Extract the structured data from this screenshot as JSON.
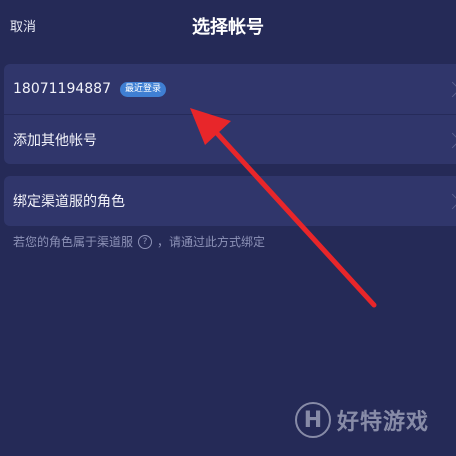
{
  "header": {
    "cancel_label": "取消",
    "title": "选择帐号"
  },
  "accounts": {
    "items": [
      {
        "label": "18071194887",
        "badge": "最近登录"
      },
      {
        "label": "添加其他帐号"
      }
    ]
  },
  "channel": {
    "label": "绑定渠道服的角色",
    "hint_before": "若您的角色属于渠道服",
    "hint_icon": "question-circle-icon",
    "hint_after": "，请通过此方式绑定"
  },
  "annotation": {
    "color": "#e8262a"
  },
  "watermark": {
    "logo_letter": "H",
    "text": "好特游戏"
  }
}
